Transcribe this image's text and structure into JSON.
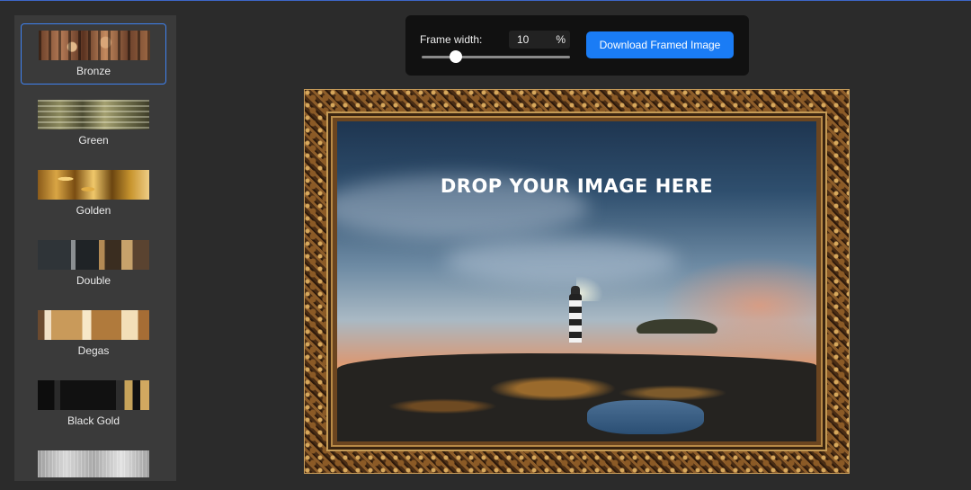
{
  "sidebar": {
    "items": [
      {
        "label": "Bronze",
        "selected": true
      },
      {
        "label": "Green",
        "selected": false
      },
      {
        "label": "Golden",
        "selected": false
      },
      {
        "label": "Double",
        "selected": false
      },
      {
        "label": "Degas",
        "selected": false
      },
      {
        "label": "Black Gold",
        "selected": false
      },
      {
        "label": "",
        "selected": false
      }
    ]
  },
  "controls": {
    "frame_width_label": "Frame width:",
    "frame_width_value": "10",
    "frame_width_unit": "%",
    "slider_fraction": 0.23,
    "download_label": "Download Framed Image"
  },
  "canvas": {
    "drop_text": "DROP YOUR IMAGE HERE"
  },
  "colors": {
    "accent": "#1a7cf5",
    "selected_border": "#3f82f0",
    "background": "#2b2b2b",
    "sidebar_bg": "#3a3a3a",
    "panel_bg": "#111111"
  }
}
